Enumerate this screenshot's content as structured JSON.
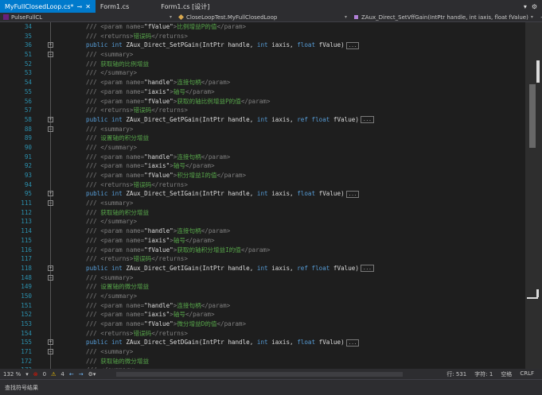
{
  "tabs": [
    {
      "label": "MyFullClosedLoop.cs*",
      "active": true
    },
    {
      "label": "Form1.cs",
      "active": false
    },
    {
      "label": "Form1.cs [设计]",
      "active": false
    }
  ],
  "window_controls": [
    "▾",
    "⚙"
  ],
  "nav": {
    "project": "PulseFullCL",
    "class": "CloseLoopTest.MyFullClosedLoop",
    "member": "ZAux_Direct_SetVffGain(IntPtr handle, int iaxis, float fValue)"
  },
  "lines": [
    {
      "n": "34",
      "k": "doc",
      "t": "/// <param name=\"fValue\">比例增益P的值</param>"
    },
    {
      "n": "35",
      "k": "doc",
      "t": "/// <returns>错误码</returns>"
    },
    {
      "n": "36",
      "k": "sig",
      "fold": "+",
      "t": "public int ZAux_Direct_SetPGain(IntPtr handle, int iaxis, float fValue)"
    },
    {
      "n": "51",
      "k": "doc",
      "fold": "-",
      "t": "/// <summary>"
    },
    {
      "n": "52",
      "k": "doc",
      "t": "/// 获取轴的比例增益"
    },
    {
      "n": "53",
      "k": "doc",
      "t": "/// </summary>"
    },
    {
      "n": "54",
      "k": "doc",
      "t": "/// <param name=\"handle\">连接句柄</param>"
    },
    {
      "n": "55",
      "k": "doc",
      "t": "/// <param name=\"iaxis\">轴号</param>"
    },
    {
      "n": "56",
      "k": "doc",
      "t": "/// <param name=\"fValue\">获取的轴比例增益P的值</param>"
    },
    {
      "n": "57",
      "k": "doc",
      "t": "/// <returns>错误码</returns>"
    },
    {
      "n": "58",
      "k": "sig",
      "fold": "+",
      "t": "public int ZAux_Direct_GetPGain(IntPtr handle, int iaxis, ref float fValue)"
    },
    {
      "n": "88",
      "k": "doc",
      "fold": "-",
      "t": "/// <summary>"
    },
    {
      "n": "89",
      "k": "doc",
      "t": "/// 设置轴的积分增益"
    },
    {
      "n": "90",
      "k": "doc",
      "t": "/// </summary>"
    },
    {
      "n": "91",
      "k": "doc",
      "t": "/// <param name=\"handle\">连接句柄</param>"
    },
    {
      "n": "92",
      "k": "doc",
      "t": "/// <param name=\"iaxis\">轴号</param>"
    },
    {
      "n": "93",
      "k": "doc",
      "t": "/// <param name=\"fValue\">积分增益I的值</param>"
    },
    {
      "n": "94",
      "k": "doc",
      "t": "/// <returns>错误码</returns>"
    },
    {
      "n": "95",
      "k": "sig",
      "fold": "+",
      "t": "public int ZAux_Direct_SetIGain(IntPtr handle, int iaxis, float fValue)"
    },
    {
      "n": "111",
      "k": "doc",
      "fold": "-",
      "t": "/// <summary>"
    },
    {
      "n": "112",
      "k": "doc",
      "t": "/// 获取轴的积分增益"
    },
    {
      "n": "113",
      "k": "doc",
      "t": "/// </summary>"
    },
    {
      "n": "114",
      "k": "doc",
      "t": "/// <param name=\"handle\">连接句柄</param>"
    },
    {
      "n": "115",
      "k": "doc",
      "t": "/// <param name=\"iaxis\">轴号</param>"
    },
    {
      "n": "116",
      "k": "doc",
      "t": "/// <param name=\"fValue\">获取的轴积分增益I的值</param>"
    },
    {
      "n": "117",
      "k": "doc",
      "t": "/// <returns>错误码</returns>"
    },
    {
      "n": "118",
      "k": "sig",
      "fold": "+",
      "t": "public int ZAux_Direct_GetIGain(IntPtr handle, int iaxis, ref float fValue)"
    },
    {
      "n": "148",
      "k": "doc",
      "fold": "-",
      "t": "/// <summary>"
    },
    {
      "n": "149",
      "k": "doc",
      "t": "/// 设置轴的微分增益"
    },
    {
      "n": "150",
      "k": "doc",
      "t": "/// </summary>"
    },
    {
      "n": "151",
      "k": "doc",
      "t": "/// <param name=\"handle\">连接句柄</param>"
    },
    {
      "n": "152",
      "k": "doc",
      "t": "/// <param name=\"iaxis\">轴号</param>"
    },
    {
      "n": "153",
      "k": "doc",
      "t": "/// <param name=\"fValue\">微分增益D的值</param>"
    },
    {
      "n": "154",
      "k": "doc",
      "t": "/// <returns>错误码</returns>"
    },
    {
      "n": "155",
      "k": "sig",
      "fold": "+",
      "t": "public int ZAux_Direct_SetDGain(IntPtr handle, int iaxis, float fValue)"
    },
    {
      "n": "171",
      "k": "doc",
      "fold": "-",
      "t": "/// <summary>"
    },
    {
      "n": "172",
      "k": "doc",
      "t": "/// 获取轴的微分增益"
    },
    {
      "n": "173",
      "k": "doc",
      "t": "/// </summary>"
    }
  ],
  "status": {
    "zoom": "132 %",
    "errors": "0",
    "warnings": "4",
    "line": "行: 531",
    "char": "字符: 1",
    "mode": "空格",
    "eol": "CRLF"
  },
  "bottom_panel": {
    "label": "查找符号结果"
  },
  "colors": {
    "accent": "#007acc",
    "comment": "#57a64a",
    "keyword": "#569cd6",
    "linenumber": "#2b91af"
  }
}
